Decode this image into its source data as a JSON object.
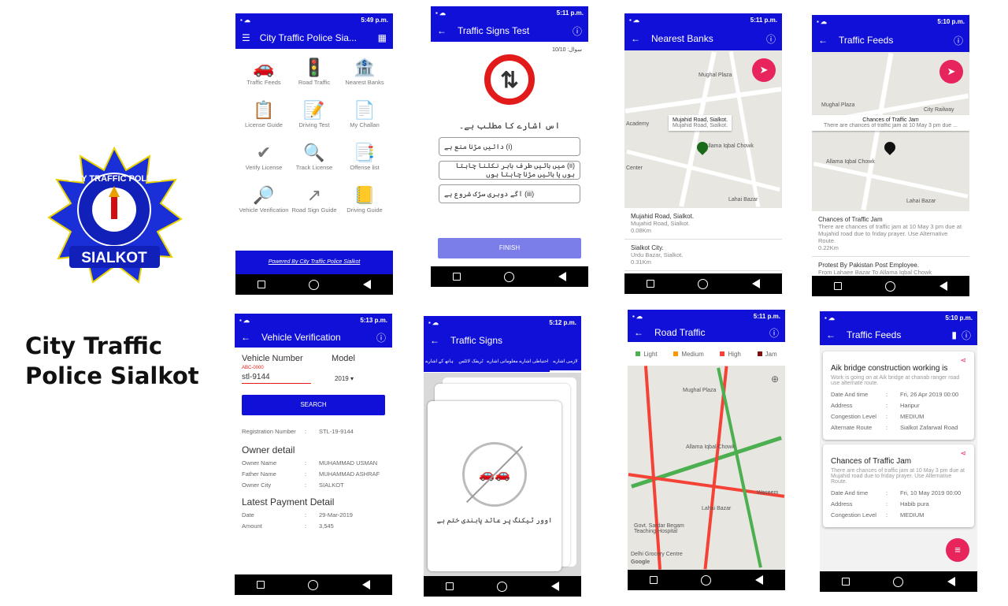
{
  "brand": {
    "title_line1": "City Traffic",
    "title_line2": "Police Sialkot",
    "logo_top": "CITY TRAFFIC POLICE",
    "logo_bottom": "SIALKOT",
    "blue": "#1010d8",
    "pink": "#e8245c"
  },
  "status": {
    "t1": "5:49 p.m.",
    "t2": "5:11 p.m.",
    "t3": "5:11 p.m.",
    "t4": "5:10 p.m.",
    "t5": "5:13 p.m.",
    "t6": "5:12 p.m.",
    "t7": "5:11 p.m.",
    "t8": "5:10 p.m.",
    "net": "3G"
  },
  "s1": {
    "title": "City Traffic Police Sia...",
    "items": [
      "Traffic Feeds",
      "Road Traffic",
      "Nearest Banks",
      "License Guide",
      "Driving Test",
      "My Challan",
      "Verify License",
      "Track License",
      "Offense list",
      "Vehicle Verification",
      "Road Sign Guide",
      "Driving Guide"
    ],
    "footer": "Powered By City Traffic Police Sialkot"
  },
  "s2": {
    "title": "Traffic Signs Test",
    "counter": "سوال: 10/10",
    "question": "اس اشارے کا مطلب ہے۔",
    "opts": [
      "(i) دائیں مڑنا منع ہے",
      "(ii) میں بائیں طرف باہر نکلنا چاہتا ہوں یا بائیں مڑنا چاہتا ہوں",
      "(iii) آگے دوہری سڑک شروع ہے"
    ],
    "finish": "FINISH"
  },
  "s3": {
    "title": "Nearest Banks",
    "popup_title": "Mujahid Road, Sialkot.",
    "popup_sub": "Mujahid Road, Sialkot.",
    "map_labels": [
      "Mughal Plaza",
      "Allama Iqbal Chowk",
      "Lahai Bazar",
      "Academy",
      "Center"
    ],
    "list": [
      {
        "name": "Mujahid Road, Sialkot.",
        "addr": "Mujahid Road, Sialkot.",
        "dist": "0.08Km"
      },
      {
        "name": "Sialkot City.",
        "addr": "Urdu Bazar, Sialkot.",
        "dist": "0.31Km"
      }
    ]
  },
  "s4": {
    "title": "Traffic Feeds",
    "popup_title": "Chances of Traffic Jam",
    "popup_sub": "There are chances of traffic jam at 10 May 3 pm due ...",
    "map_labels": [
      "Mughal Plaza",
      "City Railway",
      "Allama Iqbal Chowk",
      "Lahai Bazar"
    ],
    "list": [
      {
        "name": "Chances of Traffic Jam",
        "addr": "There are chances of traffic jam at 10 May 3 pm due at Mujahid road due to friday prayer. Use Alternative Route.",
        "dist": "0.22Km"
      },
      {
        "name": "Protest By Pakistan Post Employee.",
        "addr": "From Lahaee Bazar To Allama Iqbal Chowk",
        "dist": ""
      }
    ]
  },
  "s5": {
    "title": "Vehicle Verification",
    "vn_label": "Vehicle Number",
    "vn_hint": "ABC-0000",
    "vn_value": "stl-9144",
    "model_label": "Model",
    "model_value": "2019",
    "search": "SEARCH",
    "reg_k": "Registration Number",
    "reg_v": "STL-19-9144",
    "owner_h": "Owner detail",
    "rows": [
      {
        "k": "Owner Name",
        "v": "MUHAMMAD USMAN"
      },
      {
        "k": "Father Name",
        "v": "MUHAMMAD ASHRAF"
      },
      {
        "k": "Owner City",
        "v": "SIALKOT"
      }
    ],
    "pay_h": "Latest Payment Detail",
    "pay": [
      {
        "k": "Date",
        "v": "29-Mar-2019"
      },
      {
        "k": "Amount",
        "v": "3,545"
      }
    ]
  },
  "s6": {
    "title": "Traffic Signs",
    "tabs": [
      "لازمی اشارے",
      "احتیاطی اشارے",
      "معلوماتی اشارے",
      "ٹریفک لائٹس",
      "ہاتھ کے اشارے"
    ],
    "caption": "اوور ٹیکنگ پر عائد پابندی ختم ہے"
  },
  "s7": {
    "title": "Road Traffic",
    "legend": [
      {
        "label": "Light",
        "color": "#4caf50"
      },
      {
        "label": "Medium",
        "color": "#ff9800"
      },
      {
        "label": "High",
        "color": "#f44336"
      },
      {
        "label": "Jam",
        "color": "#7b1010"
      }
    ],
    "map_labels": [
      "Mughal Plaza",
      "Allama Iqbal Chowk",
      "Waseem",
      "Lahai Bazar",
      "Govt. Sardar Begam Teaching Hospital",
      "Delhi Grocery Centre",
      "Google"
    ]
  },
  "s8": {
    "title": "Traffic Feeds",
    "cards": [
      {
        "title": "Aik bridge construction working is",
        "desc": "Work is going on at Aik bridge at chanab ranger road use alternate route.",
        "rows": [
          {
            "k": "Date And time",
            "v": "Fri, 26 Apr 2019 00:00"
          },
          {
            "k": "Address",
            "v": "Haripur"
          },
          {
            "k": "Congestion Level",
            "v": "MEDIUM"
          },
          {
            "k": "Alternate Route",
            "v": "Sialkot Zafarwal Road"
          }
        ]
      },
      {
        "title": "Chances of Traffic Jam",
        "desc": "There are chances of traffic jam at 10 May 3 pm due at Mujahid road due to friday prayer. Use Alternative Route.",
        "rows": [
          {
            "k": "Date And time",
            "v": "Fri, 10 May 2019 00:00"
          },
          {
            "k": "Address",
            "v": "Habib pura"
          },
          {
            "k": "Congestion Level",
            "v": "MEDIUM"
          }
        ]
      }
    ]
  }
}
